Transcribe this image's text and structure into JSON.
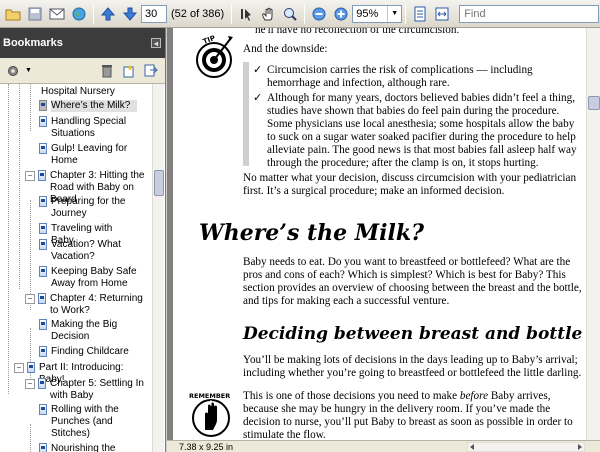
{
  "toolbar": {
    "page_number": "30",
    "page_of": "(52 of 386)",
    "zoom": "95%",
    "find_placeholder": "Find"
  },
  "bookmarks": {
    "title": "Bookmarks",
    "items": [
      {
        "label": "Hospital Nursery"
      },
      {
        "label": "Where’s the Milk?"
      },
      {
        "label": "Handling Special Situations"
      },
      {
        "label": "Gulp! Leaving for Home"
      },
      {
        "label": "Chapter 3: Hitting the Road with Baby on Board"
      },
      {
        "label": "Preparing for the Journey"
      },
      {
        "label": "Traveling with Baby"
      },
      {
        "label": "Vacation? What Vacation?"
      },
      {
        "label": "Keeping Baby Safe Away from Home"
      },
      {
        "label": "Chapter 4: Returning to Work?"
      },
      {
        "label": "Making the Big Decision"
      },
      {
        "label": "Finding Childcare"
      },
      {
        "label": "Part II: Introducing: Baby!"
      },
      {
        "label": "Chapter 5: Settling In with Baby"
      },
      {
        "label": "Rolling with the Punches (and Stitches)"
      },
      {
        "label": "Nourishing the Newbo..."
      }
    ]
  },
  "document": {
    "line_top": "he'll have no recollection of the circumcision.",
    "downside": "And the downside:",
    "bullet1": "Circumcision carries the risk of complications — including hemorrhage and infection, although rare.",
    "bullet2": "Although for many years, doctors believed babies didn’t feel a thing, studies have shown that babies do feel pain during the procedure. Some physicians use local anesthesia; some hospitals allow the baby to suck on a sugar water soaked pacifier during the procedure to help alleviate pain. The good news is that most babies fall asleep half way through the procedure; after the clamp is on, it stops hurting.",
    "para_decision": "No matter what your decision, discuss circumcision with your pediatrician first. It’s a surgical procedure; make an informed decision.",
    "heading_milk": "Where’s the Milk?",
    "para_milk": "Baby needs to eat. Do you want to breastfeed or bottlefeed? What are the pros and cons of each? Which is simplest? Which is best for Baby? This section provides an overview of choosing between the breast and the bottle, and tips for making each a successful venture.",
    "heading_deciding": "Deciding between breast and bottle",
    "para_decisions": "You’ll be making lots of decisions in the days leading up to Baby’s arrival; including whether you’re going to breastfeed or bottlefeed the little darling.",
    "para_remember_a": "This is one of those decisions you need to make ",
    "para_remember_em": "before",
    "para_remember_b": " Baby arrives, because she may be hungry in the delivery room. If you’ve made the decision to nurse, you’ll put Baby to breast as soon as possible in order to stimulate the flow.",
    "tip_label": "TIP",
    "remember_label": "REMEMBER"
  },
  "status": {
    "page_size": "7.38 x 9.25 in"
  }
}
